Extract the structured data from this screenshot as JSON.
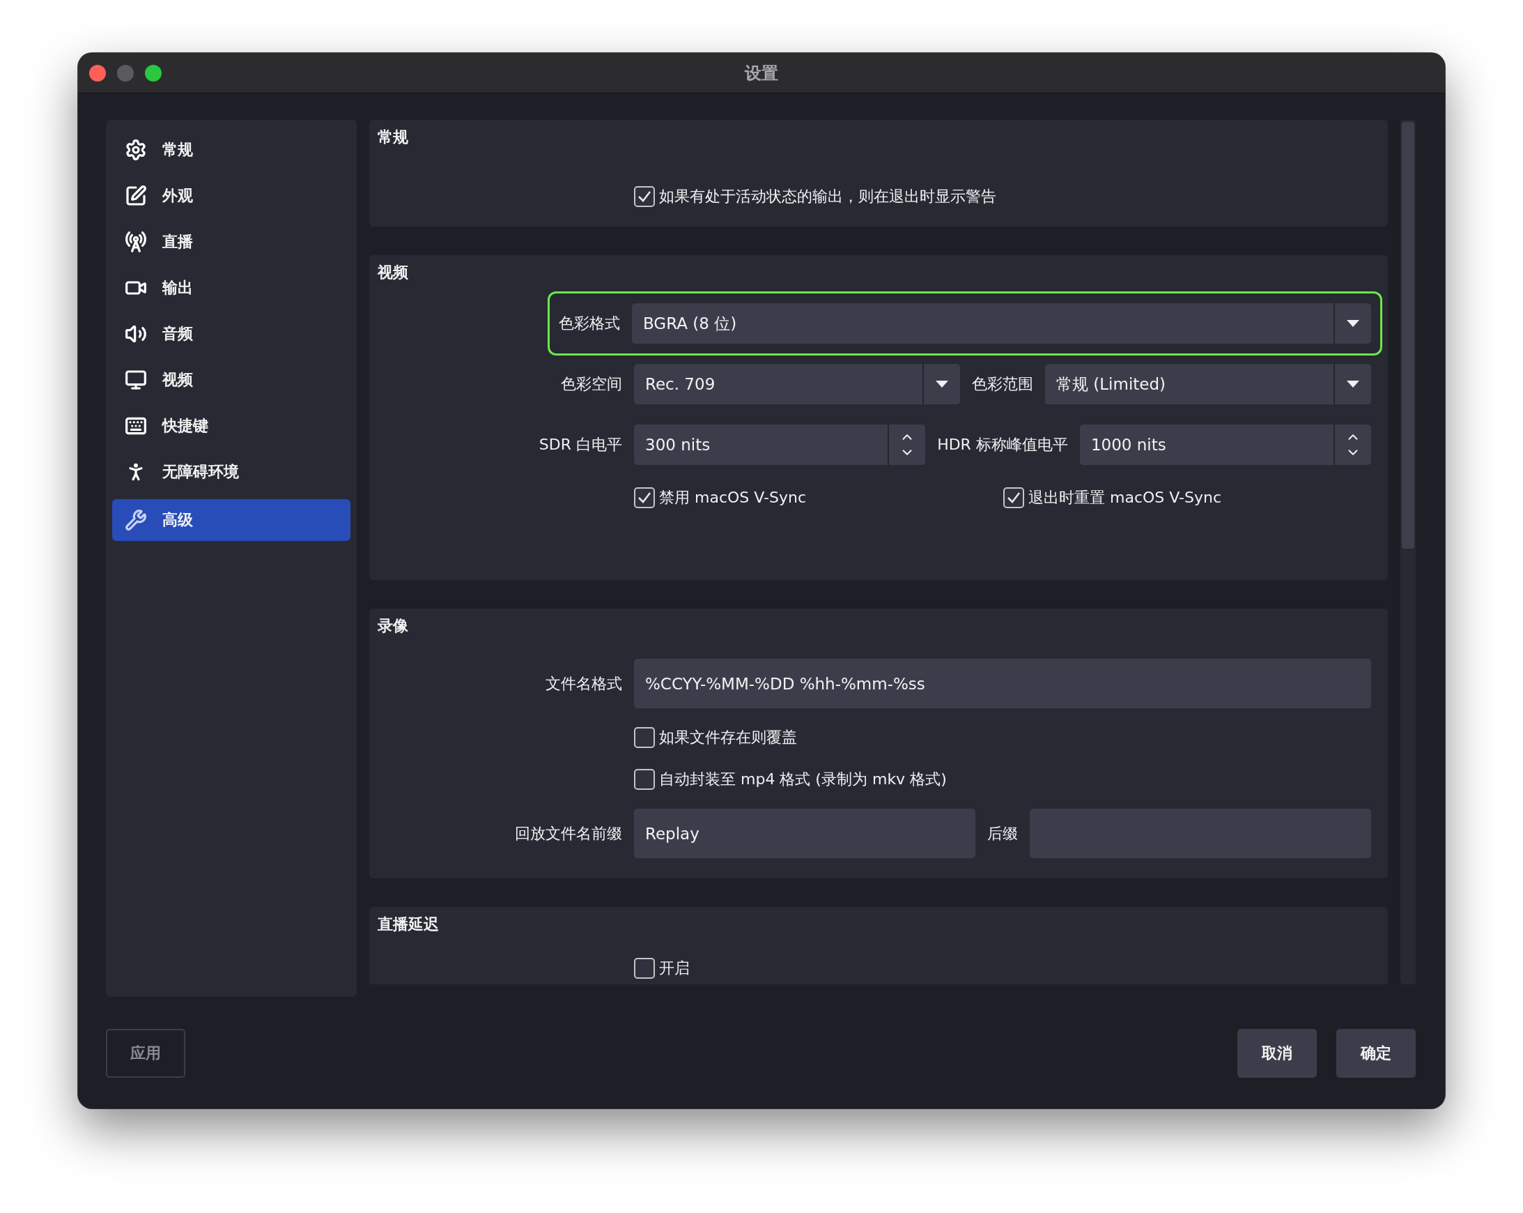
{
  "window": {
    "title": "设置"
  },
  "sidebar": {
    "items": [
      {
        "label": "常规",
        "selected": false
      },
      {
        "label": "外观",
        "selected": false
      },
      {
        "label": "直播",
        "selected": false
      },
      {
        "label": "输出",
        "selected": false
      },
      {
        "label": "音频",
        "selected": false
      },
      {
        "label": "视频",
        "selected": false
      },
      {
        "label": "快捷键",
        "selected": false
      },
      {
        "label": "无障碍环境",
        "selected": false
      },
      {
        "label": "高级",
        "selected": true
      }
    ]
  },
  "sections": [
    {
      "title": "常规",
      "rows": [
        {
          "kind": "checkbox",
          "label": "如果有处于活动状态的输出，则在退出时显示警告",
          "checked": true
        }
      ]
    },
    {
      "title": "视频",
      "rows": [
        {
          "kind": "field",
          "field": {
            "kind": "select",
            "label": "色彩格式",
            "value": "BGRA (8 位)"
          },
          "highlighted": true
        },
        {
          "kind": "pair",
          "fields": [
            {
              "kind": "select",
              "label": "色彩空间",
              "value": "Rec. 709"
            },
            {
              "kind": "select",
              "label": "色彩范围",
              "value": "常规 (Limited)"
            }
          ]
        },
        {
          "kind": "pair",
          "fields": [
            {
              "kind": "spin",
              "label": "SDR 白电平",
              "value": "300 nits"
            },
            {
              "kind": "spin",
              "label": "HDR 标称峰值电平",
              "value": "1000 nits"
            }
          ]
        },
        {
          "kind": "checkbox_pair",
          "items": [
            {
              "label": "禁用 macOS V-Sync",
              "checked": true
            },
            {
              "label": "退出时重置 macOS V-Sync",
              "checked": true
            }
          ]
        }
      ]
    },
    {
      "title": "录像",
      "rows": [
        {
          "kind": "field",
          "field": {
            "kind": "text",
            "label": "文件名格式",
            "value": "%CCYY-%MM-%DD %hh-%mm-%ss"
          }
        },
        {
          "kind": "checkbox",
          "label": "如果文件存在则覆盖",
          "checked": false
        },
        {
          "kind": "checkbox",
          "label": "自动封装至 mp4 格式 (录制为 mkv 格式)",
          "checked": false
        },
        {
          "kind": "pair",
          "fields": [
            {
              "kind": "text",
              "label": "回放文件名前缀",
              "value": "Replay"
            },
            {
              "kind": "text",
              "label": "后缀"
            }
          ]
        }
      ]
    },
    {
      "title": "直播延迟",
      "rows": [
        {
          "kind": "checkbox",
          "label": "开启",
          "checked": false
        }
      ]
    }
  ],
  "buttons": [
    {
      "label": "应用",
      "disabled": true
    },
    {
      "label": "取消",
      "disabled": false
    },
    {
      "label": "确定",
      "disabled": false
    }
  ]
}
